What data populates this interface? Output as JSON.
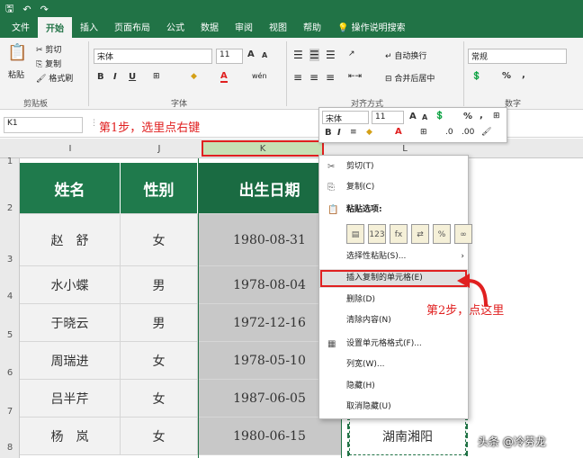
{
  "quick_access": {
    "save": "🖫",
    "undo": "↶",
    "redo": "↷"
  },
  "tabs": [
    "文件",
    "开始",
    "插入",
    "页面布局",
    "公式",
    "数据",
    "审阅",
    "视图",
    "帮助"
  ],
  "tell_me": "操作说明搜索",
  "ribbon": {
    "clipboard": {
      "paste": "粘贴",
      "cut": "剪切",
      "copy": "复制",
      "format_painter": "格式刷",
      "group": "剪贴板"
    },
    "font": {
      "name": "宋体",
      "size": "11",
      "bold": "B",
      "italic": "I",
      "underline": "U",
      "bigger": "A",
      "smaller": "A",
      "fontcolor": "A",
      "wen": "wén",
      "group": "字体"
    },
    "alignment": {
      "wrap": "自动换行",
      "merge": "合并后居中",
      "group": "对齐方式"
    },
    "number": {
      "format": "常规",
      "group": "数字",
      "pct": "%",
      "comma": ","
    }
  },
  "formula_bar": {
    "name_box": "K1",
    "fx": "fx"
  },
  "columns": [
    "I",
    "J",
    "K",
    "L"
  ],
  "rows": [
    "1",
    "2",
    "3",
    "4",
    "5",
    "6",
    "7",
    "8"
  ],
  "table": {
    "headers": [
      "姓名",
      "性别",
      "出生日期",
      ""
    ],
    "rows": [
      [
        "赵　舒",
        "女",
        "1980-08-31"
      ],
      [
        "水小蝶",
        "男",
        "1978-08-04"
      ],
      [
        "于晓云",
        "男",
        "1972-12-16"
      ],
      [
        "周瑞进",
        "女",
        "1978-05-10"
      ],
      [
        "吕半芹",
        "女",
        "1987-06-05"
      ],
      [
        "杨　岚",
        "女",
        "1980-06-15",
        "湖南湘阳"
      ]
    ]
  },
  "annotations": {
    "step1": "第1步，选里点右键",
    "step2": "第2步，点这里"
  },
  "mini_toolbar": {
    "font": "宋体",
    "size": "11",
    "pct": "%",
    "comma": ",",
    "bold": "B",
    "italic": "I"
  },
  "context_menu": {
    "cut": "剪切(T)",
    "copy": "复制(C)",
    "paste_options": "粘贴选项:",
    "paste_special": "选择性粘贴(S)...",
    "insert_copied": "插入复制的单元格(E)",
    "delete": "删除(D)",
    "clear": "清除内容(N)",
    "format_cells": "设置单元格格式(F)...",
    "col_width": "列宽(W)...",
    "hide": "隐藏(H)",
    "unhide": "取消隐藏(U)"
  },
  "watermark": "头条 @冷芬龙",
  "colors": {
    "excel_green": "#217346",
    "header_green": "#1f7a4c",
    "annotation_red": "#e02020"
  }
}
